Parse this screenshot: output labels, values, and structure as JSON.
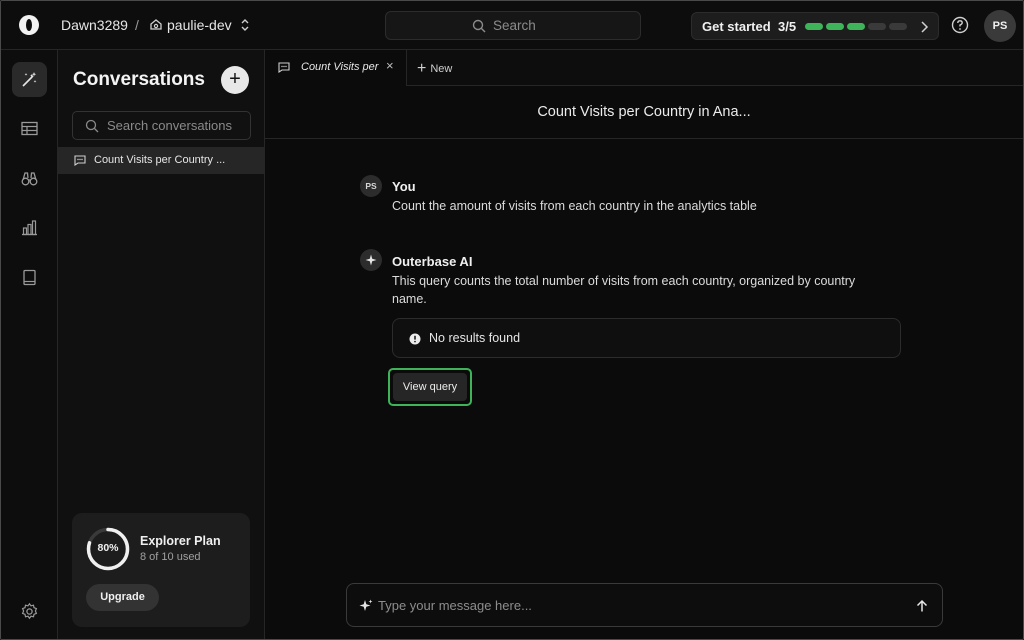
{
  "topbar": {
    "workspace": "Dawn3289",
    "separator": "/",
    "project": "paulie-dev",
    "search_placeholder": "Search",
    "get_started": {
      "label": "Get started",
      "progress_text": "3/5",
      "completed": 3,
      "total": 5
    },
    "user_initials": "PS"
  },
  "rail": {
    "icons": [
      "magic-wand-icon",
      "table-icon",
      "binoculars-icon",
      "bar-chart-icon",
      "book-icon",
      "gear-icon"
    ],
    "active": "magic-wand-icon"
  },
  "sidebar": {
    "title": "Conversations",
    "search_placeholder": "Search conversations",
    "items": [
      {
        "label": "Count Visits per Country ..."
      }
    ],
    "plan": {
      "percent_text": "80%",
      "percent": 0.8,
      "name": "Explorer Plan",
      "usage": "8 of 10 used",
      "upgrade_label": "Upgrade"
    }
  },
  "main": {
    "tabs": [
      {
        "label": "Count Visits per Country in Analytics"
      }
    ],
    "new_tab_label": "New",
    "conversation_title": "Count Visits per Country in Ana...",
    "messages": [
      {
        "initials": "PS",
        "author": "You",
        "text": "Count the amount of visits from each country in the analytics table"
      },
      {
        "author": "Outerbase AI",
        "text_line1": "This query counts the total number of visits from each country, organized by country",
        "text_line2": "name.",
        "result": "No results found",
        "view_query_label": "View query"
      }
    ],
    "composer_placeholder": "Type your message here..."
  },
  "colors": {
    "accent_green": "#3fb35a",
    "background": "#0b0b0b",
    "panel": "#1d1d1d"
  }
}
